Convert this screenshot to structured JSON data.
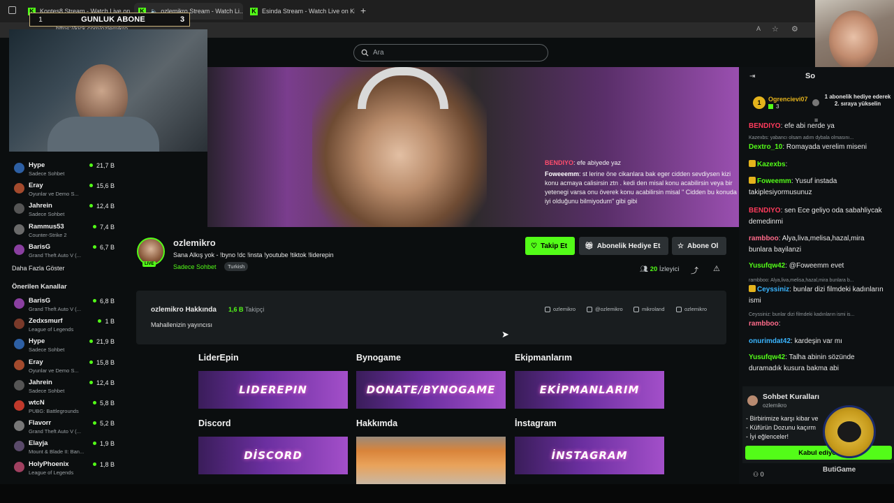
{
  "browser": {
    "tabs": [
      {
        "label": "Kontes8 Stream - Watch Live on..."
      },
      {
        "label": "ozlemikro Stream - Watch Li..."
      },
      {
        "label": "Esinda Stream - Watch Live on Ki..."
      }
    ],
    "url": "https://kick.com/ozlemikro"
  },
  "overlay": {
    "gunluk_left": "1",
    "gunluk_title": "GUNLUK ABONE",
    "gunluk_right": "3"
  },
  "search": {
    "placeholder": "Ara"
  },
  "video_chat_overlay": [
    {
      "user": "BENDIYO",
      "text": ": efe abiyede yaz"
    },
    {
      "user": "Foweeemm",
      "text": ": st lerine öne cikanlara bak eger cidden sevdiysen kizi konu acmaya calisirsin ztn . kedi den misal konu acabilirsin veya bir yetenegi varsa onu överek konu acabilirsin misal \" Cidden bu konuda iyi olduğunu bilmiyodum\" gibi gibi"
    }
  ],
  "sidebar": {
    "following": [
      {
        "name": "Hype",
        "category": "Sadece Sohbet",
        "viewers": "21,7 B",
        "color": "#2d5fa3"
      },
      {
        "name": "Eray",
        "category": "Oyunlar ve Demo S...",
        "viewers": "15,6 B",
        "color": "#a34a2d"
      },
      {
        "name": "Jahrein",
        "category": "Sadece Sohbet",
        "viewers": "12,4 B",
        "color": "#555"
      },
      {
        "name": "Rammus53",
        "category": "Counter-Strike 2",
        "viewers": "7,4 B",
        "color": "#6a6a6a"
      },
      {
        "name": "BarisG",
        "category": "Grand Theft Auto V (...",
        "viewers": "6,7 B",
        "color": "#8a3fa0"
      }
    ],
    "show_more": "Daha Fazla Göster",
    "recommended_title": "Önerilen Kanallar",
    "recommended": [
      {
        "name": "BarisG",
        "category": "Grand Theft Auto V (...",
        "viewers": "6,8 B",
        "color": "#8a3fa0"
      },
      {
        "name": "Zedxsmurf",
        "category": "League of Legends",
        "viewers": "1 B",
        "color": "#7a3a2a"
      },
      {
        "name": "Hype",
        "category": "Sadece Sohbet",
        "viewers": "21,9 B",
        "color": "#2d5fa3"
      },
      {
        "name": "Eray",
        "category": "Oyunlar ve Demo S...",
        "viewers": "15,8 B",
        "color": "#a34a2d"
      },
      {
        "name": "Jahrein",
        "category": "Sadece Sohbet",
        "viewers": "12,4 B",
        "color": "#555"
      },
      {
        "name": "wtcN",
        "category": "PUBG: Battlegrounds",
        "viewers": "5,8 B",
        "color": "#c0392b"
      },
      {
        "name": "Flavorr",
        "category": "Grand Theft Auto V (...",
        "viewers": "5,2 B",
        "color": "#777"
      },
      {
        "name": "Elayja",
        "category": "Mount & Blade II: Ban...",
        "viewers": "1,9 B",
        "color": "#5a4a6a"
      },
      {
        "name": "HolyPhoenix",
        "category": "League of Legends",
        "viewers": "1,8 B",
        "color": "#a04060"
      }
    ]
  },
  "channel": {
    "name": "ozlemikro",
    "live": "LIVE",
    "title": "Sana Alkış yok - !byno !dc !insta !youtube !tiktok !liderepin",
    "category": "Sadece Sohbet",
    "tag": "Turkish",
    "follow": "Takip Et",
    "gift": "Abonelik Hediye Et",
    "subscribe": "Abone Ol",
    "viewers_count": "20",
    "viewers_label": "İzleyici"
  },
  "about": {
    "title": "ozlemikro Hakkında",
    "followers_count": "1,6 B",
    "followers_label": "Takipçi",
    "description": "Mahallenizin yayıncısı",
    "socials": [
      "ozlemikro",
      "@ozlemikro",
      "mikroland",
      "ozlemikro"
    ]
  },
  "panels": [
    {
      "title": "LiderEpin",
      "image_text": "LIDEREPIN"
    },
    {
      "title": "Bynogame",
      "image_text": "DONATE/BYNOGAME"
    },
    {
      "title": "Ekipmanlarım",
      "image_text": "EKİPMANLARIM"
    },
    {
      "title": "Discord",
      "image_text": "DİSCORD"
    },
    {
      "title": "Hakkımda",
      "image_text": ""
    },
    {
      "title": "İnstagram",
      "image_text": "İNSTAGRAM"
    }
  ],
  "chat": {
    "header": "So",
    "pinned_user": "Ogrencievi07",
    "pinned_rank": "1",
    "pinned_count": "3",
    "pinned_text": "1 abonelik hediye ederek 2. sıraya yükselin",
    "messages": [
      {
        "user": "BENDIYO",
        "text": ": efe abi nerde ya",
        "color": "#ff3b5c",
        "reply": ""
      },
      {
        "user": "Dextro_10",
        "text": ": Romayada verelim miseni",
        "color": "#53fc18",
        "reply": "Kazexbs: yabancı olsam adım dybala olmasını..."
      },
      {
        "user": "Kazexbs",
        "text": ":",
        "color": "#53fc18",
        "reply": ""
      },
      {
        "user": "Foweemm",
        "text": ": Yusuf instada takiplesiyormusunuz",
        "color": "#53fc18",
        "reply": ""
      },
      {
        "user": "BENDIYO",
        "text": ": sen Ece geliyo oda sabahliycak demedinmi",
        "color": "#ff3b5c",
        "reply": ""
      },
      {
        "user": "rambboo",
        "text": ": Alya,liva,melisa,hazal,mira bunlara bayilanzi",
        "color": "#ff6b8a",
        "reply": ""
      },
      {
        "user": "Yusufqw42",
        "text": ": @Foweemm evet",
        "color": "#53fc18",
        "reply": ""
      },
      {
        "user": "Ceyssiniz",
        "text": ": bunlar dizi filmdeki kadınların ismi",
        "color": "#3ab5ff",
        "reply": "rambboo: Alya,liva,melisa,hazal,mira bunlara b..."
      },
      {
        "user": "rambboo",
        "text": ":",
        "color": "#ff6b8a",
        "reply": "Ceyssiniz: bunlar dizi filmdeki kadınların ismi is..."
      },
      {
        "user": "onurimdat42",
        "text": ": kardeşin var mı",
        "color": "#3ab5ff",
        "reply": ""
      },
      {
        "user": "Yusufqw42",
        "text": ": Talha abinin sözünde duramadık kusura bakma abi",
        "color": "#53fc18",
        "reply": ""
      }
    ],
    "rules_title": "Sohbet Kuralları",
    "rules_by": "ozlemikro",
    "rules": [
      "- Birbirimize karşı kibar ve",
      "- Küfürün Dozunu kaçırm",
      "- İyi eğlenceler!"
    ],
    "accept": "Kabul ediyor",
    "count": "0",
    "sponsor": "ButiGame"
  }
}
